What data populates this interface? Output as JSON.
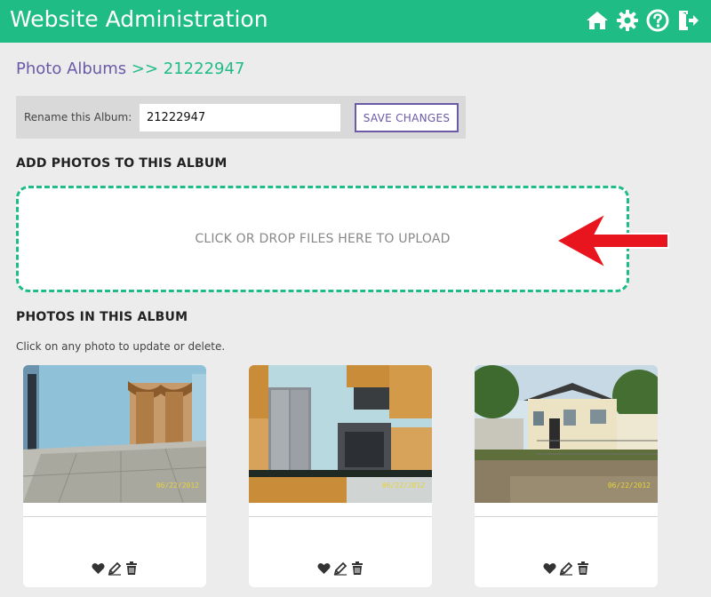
{
  "header": {
    "title": "Website Administration",
    "icons": [
      "home-icon",
      "settings-icon",
      "help-icon",
      "logout-icon"
    ],
    "bg_color": "#1fbd85"
  },
  "breadcrumb": {
    "parent": "Photo Albums",
    "separator": ">>",
    "current": "21222947"
  },
  "rename": {
    "label": "Rename this Album:",
    "value": "21222947",
    "button": "SAVE CHANGES"
  },
  "upload": {
    "heading": "ADD PHOTOS TO THIS ALBUM",
    "dropzone_text": "CLICK OR DROP FILES HERE TO UPLOAD",
    "annotation": "red-arrow-pointing-left"
  },
  "photos_section": {
    "heading": "PHOTOS IN THIS ALBUM",
    "hint": "Click on any photo to update or delete.",
    "photos": [
      {
        "scene": "empty-room-interior",
        "date": "06/22/2012",
        "actions": [
          "heart-icon",
          "edit-icon",
          "trash-icon"
        ]
      },
      {
        "scene": "kitchen-interior",
        "date": "06/22/2012",
        "actions": [
          "heart-icon",
          "edit-icon",
          "trash-icon"
        ]
      },
      {
        "scene": "house-exterior",
        "date": "06/22/2012",
        "actions": [
          "heart-icon",
          "edit-icon",
          "trash-icon"
        ]
      }
    ]
  },
  "colors": {
    "accent": "#1fbd85",
    "link_purple": "#6b5aa8",
    "annotation_red": "#e8141e"
  }
}
